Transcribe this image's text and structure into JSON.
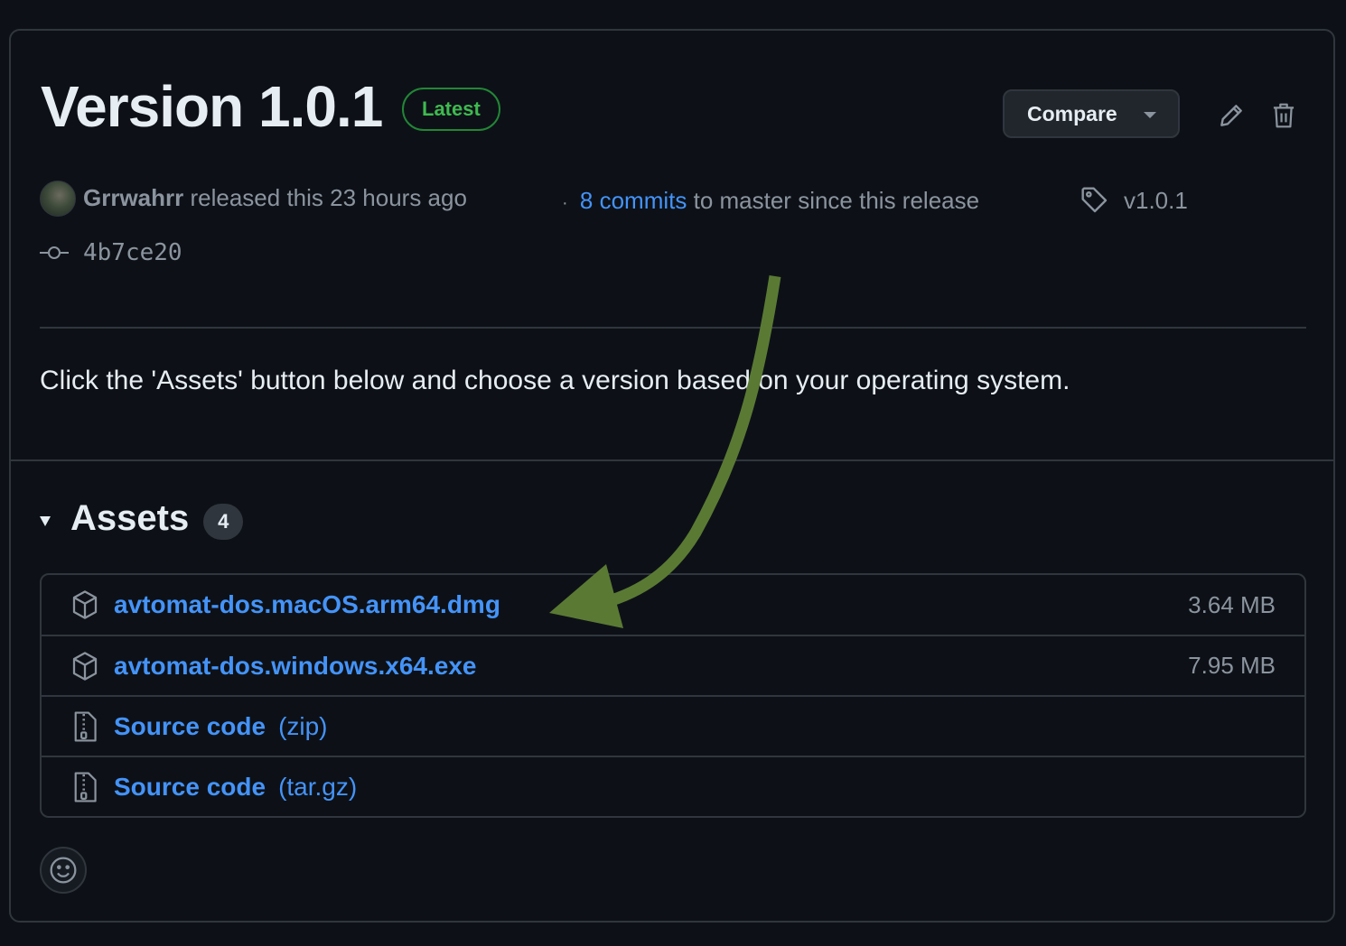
{
  "release": {
    "title": "Version 1.0.1",
    "badge": "Latest",
    "compare_label": "Compare",
    "author": "Grrwahrr",
    "released_text": " released this 23 hours ago",
    "separator": "·",
    "commits_link": "8 commits",
    "commits_text": " to master since this release",
    "tag": "v1.0.1",
    "commit_hash": "4b7ce20",
    "description": "Click the 'Assets' button below and choose a version based on your operating system."
  },
  "assets": {
    "title": "Assets",
    "count": "4",
    "items": [
      {
        "name": "avtomat-dos.macOS.arm64.dmg",
        "suffix": "",
        "size": "3.64 MB",
        "icon": "package-icon"
      },
      {
        "name": "avtomat-dos.windows.x64.exe",
        "suffix": "",
        "size": "7.95 MB",
        "icon": "package-icon"
      },
      {
        "name": "Source code",
        "suffix": "(zip)",
        "size": "",
        "icon": "file-zip-icon"
      },
      {
        "name": "Source code",
        "suffix": "(tar.gz)",
        "size": "",
        "icon": "file-zip-icon"
      }
    ]
  },
  "colors": {
    "background": "#0d1117",
    "border": "#30363d",
    "link": "#4493f8",
    "badge_green": "#3fb950",
    "annotation_arrow": "#5a7a34"
  }
}
